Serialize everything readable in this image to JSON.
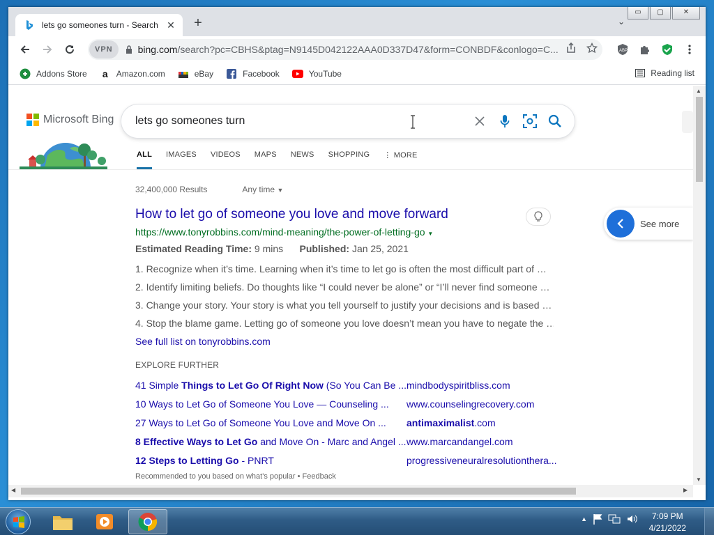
{
  "browser": {
    "tab_title": "lets go someones turn - Search",
    "tab_close": "✕",
    "new_tab": "+",
    "tab_search": "⌄",
    "window_buttons": [
      "▭",
      "▢",
      "✕"
    ],
    "vpn_label": "VPN",
    "url_host": "bing.com",
    "url_path": "/search?pc=CBHS&ptag=N9145D042122AAA0D337D47&form=CONBDF&conlogo=C...",
    "bookmarks": [
      {
        "label": "Addons Store",
        "icon": "addons-icon"
      },
      {
        "label": "Amazon.com",
        "icon": "amazon-icon"
      },
      {
        "label": "eBay",
        "icon": "ebay-icon"
      },
      {
        "label": "Facebook",
        "icon": "facebook-icon"
      },
      {
        "label": "YouTube",
        "icon": "youtube-icon"
      }
    ],
    "reading_list": "Reading list"
  },
  "bing": {
    "brand": "Microsoft Bing",
    "query": "lets go someones turn",
    "scopes": [
      "ALL",
      "IMAGES",
      "VIDEOS",
      "MAPS",
      "NEWS",
      "SHOPPING",
      "MORE"
    ],
    "results_count": "32,400,000 Results",
    "any_time": "Any time",
    "see_more": "See more"
  },
  "result": {
    "title": "How to let go of someone you love and move forward",
    "url": "https://www.tonyrobbins.com/mind-meaning/the-power-of-letting-go",
    "reading_label": "Estimated Reading Time:",
    "reading_value": "9 mins",
    "published_label": "Published:",
    "published_value": "Jan 25, 2021",
    "items": [
      "1. Recognize when it’s time. Learning when it’s time to let go is often the most difficult part of …",
      "2. Identify limiting beliefs. Do thoughts like “I could never be alone” or “I’ll never find someone …",
      "3. Change your story. Your story is what you tell yourself to justify your decisions and is based …",
      "4. Stop the blame game. Letting go of someone you love doesn’t mean you have to negate the …"
    ],
    "full_list": "See full list on tonyrobbins.com"
  },
  "explore": {
    "heading": "EXPLORE FURTHER",
    "rows": [
      {
        "pre": "41 Simple ",
        "bold": "Things to Let Go Of Right Now",
        "post": " (So You Can Be ...",
        "site_bold": "",
        "site": "mindbodyspiritbliss.com"
      },
      {
        "pre": "10 Ways to Let Go of Someone You Love — Counseling ...",
        "bold": "",
        "post": "",
        "site_bold": "",
        "site": "www.counselingrecovery.com"
      },
      {
        "pre": "27 Ways to Let Go of Someone You Love and Move On ...",
        "bold": "",
        "post": "",
        "site_bold": "antimaximalist",
        "site": ".com"
      },
      {
        "pre": "",
        "bold": "8 Effective Ways to Let Go",
        "post": " and Move On - Marc and Angel ...",
        "site_bold": "",
        "site": "www.marcandangel.com"
      },
      {
        "pre": "",
        "bold": "12 Steps to Letting Go",
        "post": " - PNRT",
        "site_bold": "",
        "site": "progressiveneuralresolutionthera..."
      }
    ],
    "footer": "Recommended to you based on what's popular • Feedback"
  },
  "taskbar": {
    "time": "7:09 PM",
    "date": "4/21/2022"
  },
  "colors": {
    "link": "#1a0dab",
    "url_green": "#006d21",
    "bing_accent": "#1a73a8",
    "see_more_blue": "#1e6fd9"
  }
}
